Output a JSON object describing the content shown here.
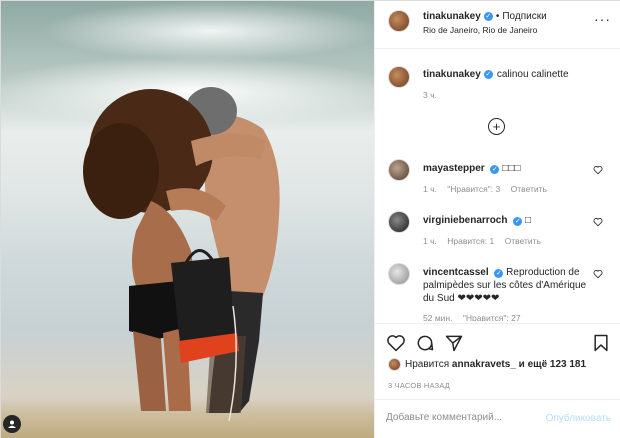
{
  "post": {
    "author": "tinakunakey",
    "follow_label": "Подписки",
    "separator": "•",
    "location": "Rio de Janeiro, Rio de Janeiro",
    "more_icon": "more-horizontal-icon",
    "caption_text": "calinou calinette",
    "caption_time": "3 ч."
  },
  "load_more_icon": "plus-circle-icon",
  "comments": [
    {
      "username": "mayastepper",
      "text": "",
      "time": "1 ч.",
      "likes": "\"Нравится\": 3",
      "reply": "Ответить"
    },
    {
      "username": "virginiebenarroch",
      "text": "",
      "time": "1 ч.",
      "likes": "Нравится: 1",
      "reply": "Ответить"
    },
    {
      "username": "vincentcassel",
      "text": "Reproduction de palmipèdes sur les côtes d'Amérique du Sud ❤❤❤❤❤",
      "time": "52 мин.",
      "likes": "\"Нравится\": 27"
    }
  ],
  "actions": {
    "like_icon": "heart-icon",
    "comment_icon": "comment-icon",
    "share_icon": "share-icon",
    "save_icon": "bookmark-icon"
  },
  "likes": {
    "prefix": "Нравится",
    "user": "annakravets_",
    "suffix": "и ещё 123 181"
  },
  "time_ago": "3 ЧАСОВ НАЗАД",
  "add_comment": {
    "placeholder": "Добавьте комментарий...",
    "publish_label": "Опубликовать"
  },
  "colors": {
    "verified": "#3897f0",
    "publish_disabled": "#b2dffc",
    "muted": "#8e8e8e"
  }
}
